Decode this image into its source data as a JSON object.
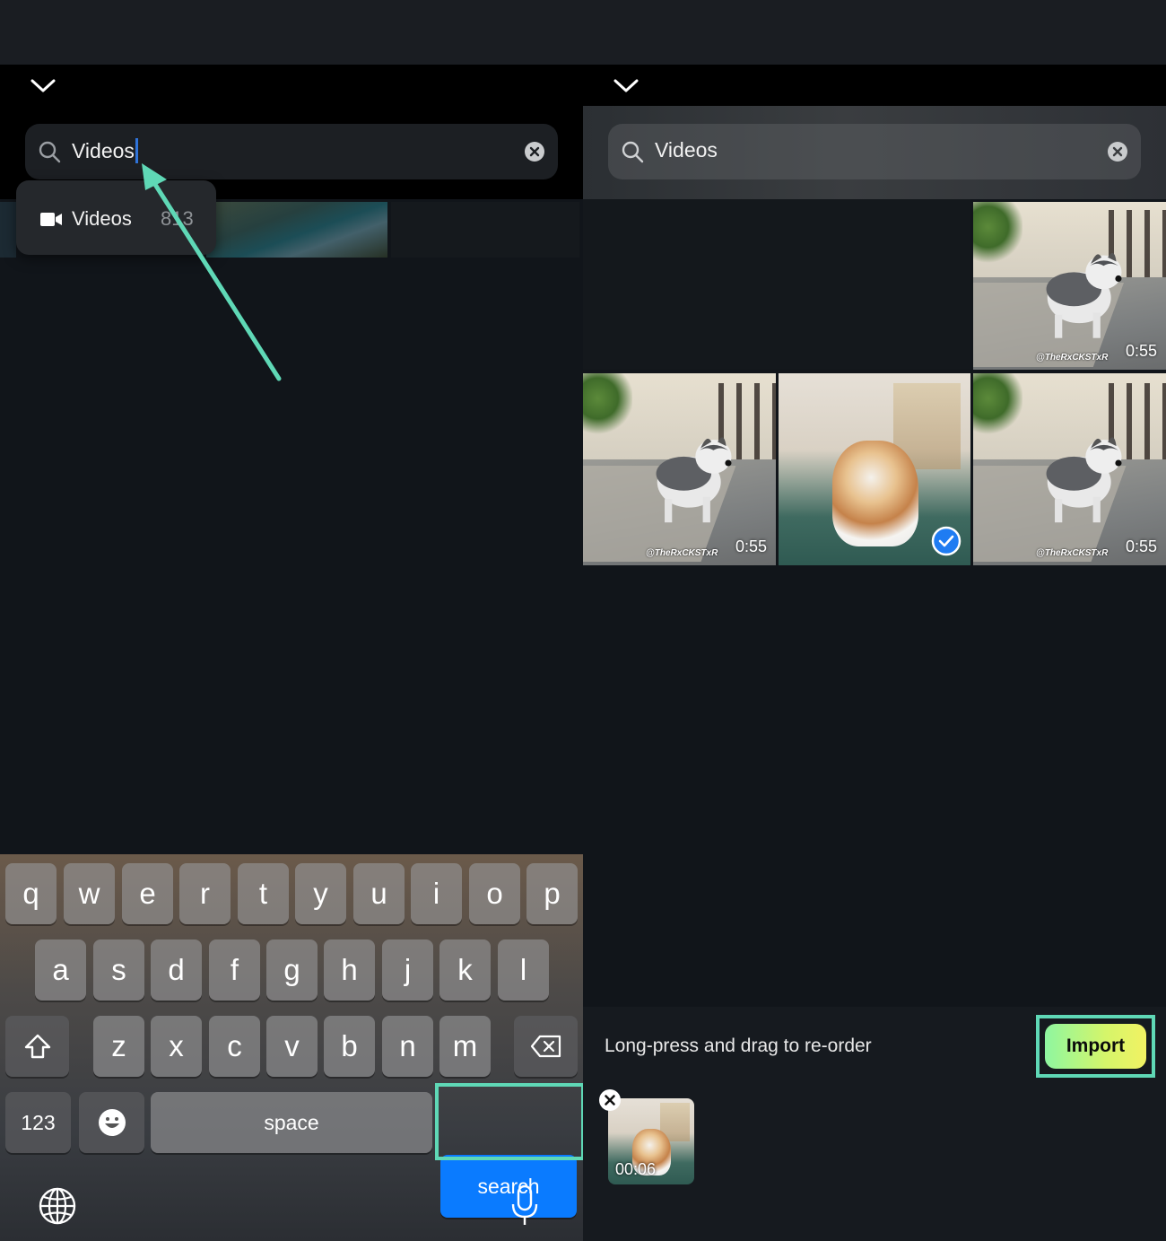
{
  "left_panel": {
    "search": {
      "value": "Videos"
    },
    "suggestion": {
      "label": "Videos",
      "count": "813"
    }
  },
  "keyboard": {
    "row1": [
      "q",
      "w",
      "e",
      "r",
      "t",
      "y",
      "u",
      "i",
      "o",
      "p"
    ],
    "row2": [
      "a",
      "s",
      "d",
      "f",
      "g",
      "h",
      "j",
      "k",
      "l"
    ],
    "row3": [
      "z",
      "x",
      "c",
      "v",
      "b",
      "n",
      "m"
    ],
    "numbers_label": "123",
    "space_label": "space",
    "search_label": "search"
  },
  "right_panel": {
    "search": {
      "value": "Videos"
    },
    "grid": [
      {
        "type": "husky",
        "watermark": "@TheRxCKSTxR",
        "duration": "0:55"
      },
      {
        "type": "husky",
        "watermark": "@TheRxCKSTxR",
        "duration": "0:55"
      },
      {
        "type": "cake",
        "selected": true
      },
      {
        "type": "husky",
        "watermark": "@TheRxCKSTxR",
        "duration": "0:55"
      }
    ],
    "hint": "Long-press and drag to re-order",
    "import_label": "Import",
    "selected_items": [
      {
        "duration": "00:06"
      }
    ]
  },
  "colors": {
    "highlight": "#5fd8b6",
    "search_key": "#0a7bff",
    "import_gradient_start": "#8ef6a0",
    "import_gradient_end": "#f2f263"
  }
}
